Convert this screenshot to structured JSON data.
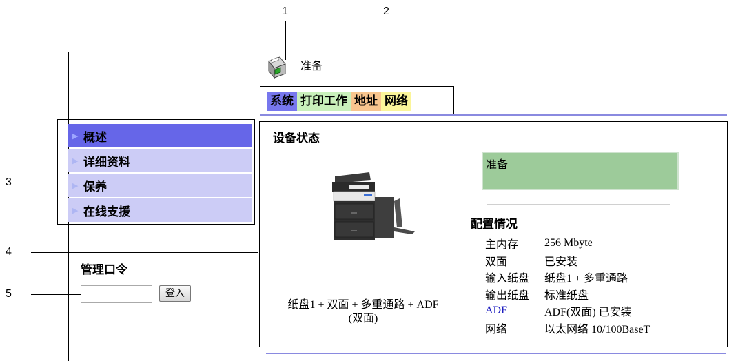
{
  "callouts": [
    "1",
    "2",
    "3",
    "4",
    "5"
  ],
  "header": {
    "status": "准备"
  },
  "tabs": [
    {
      "label": "系统"
    },
    {
      "label": "打印工作"
    },
    {
      "label": "地址"
    },
    {
      "label": "网络"
    }
  ],
  "sidebar": {
    "items": [
      {
        "label": "概述",
        "active": true
      },
      {
        "label": "详细资料",
        "active": false
      },
      {
        "label": "保养",
        "active": false
      },
      {
        "label": "在线支援",
        "active": false
      }
    ]
  },
  "password": {
    "title": "管理口令",
    "input_value": "",
    "login_label": "登入"
  },
  "main": {
    "title": "设备状态",
    "status_box": "准备",
    "device_caption_line1": "纸盘1 + 双面  + 多重通路  + ADF",
    "device_caption_line2": "(双面)",
    "config": {
      "title": "配置情况",
      "rows": [
        {
          "key": "主内存",
          "value": "256 Mbyte"
        },
        {
          "key": "双面",
          "value": "已安装"
        },
        {
          "key": "输入纸盘",
          "value": "纸盘1 + 多重通路"
        },
        {
          "key": "输出纸盘",
          "value": "标准纸盘"
        },
        {
          "key": "ADF",
          "value": "ADF(双面) 已安装"
        },
        {
          "key": "网络",
          "value": "以太网络  10/100BaseT"
        }
      ]
    }
  },
  "colors": {
    "tab_system": "#7777ee",
    "tab_jobs": "#c9f0bb",
    "tab_address": "#f8c58e",
    "tab_network": "#fbf59a",
    "sidebar_active": "#6666e8",
    "sidebar_item": "#ccccf6",
    "status_box": "#9dcb9a"
  }
}
